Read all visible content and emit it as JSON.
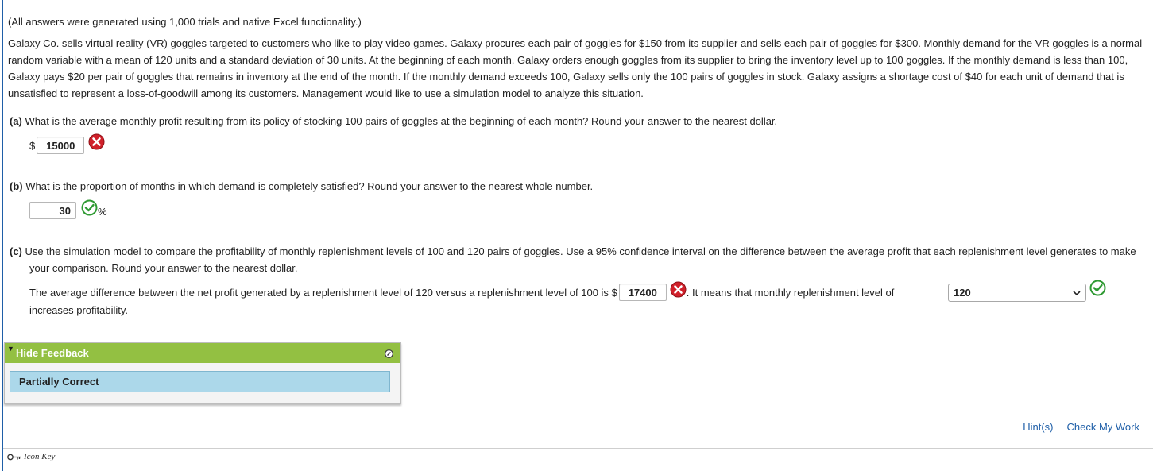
{
  "note": "(All answers were generated using 1,000 trials and native Excel functionality.)",
  "problem_text": "Galaxy Co. sells virtual reality (VR) goggles targeted to customers who like to play video games. Galaxy procures each pair of goggles for $150 from its supplier and sells each pair of goggles for $300. Monthly demand for the VR goggles is a normal random variable with a mean of 120 units and a standard deviation of 30 units. At the beginning of each month, Galaxy orders enough goggles from its supplier to bring the inventory level up to 100 goggles. If the monthly demand is less than 100, Galaxy pays $20 per pair of goggles that remains in inventory at the end of the month. If the monthly demand exceeds 100, Galaxy sells only the 100 pairs of goggles in stock. Galaxy assigns a shortage cost of $40 for each unit of demand that is unsatisfied to represent a loss-of-goodwill among its customers. Management would like to use a simulation model to analyze this situation.",
  "part_a": {
    "label": "(a)",
    "question": "What is the average monthly profit resulting from its policy of stocking 100 pairs of goggles at the beginning of each month? Round your answer to the nearest dollar.",
    "prefix": "$",
    "value": "15000",
    "status_icon": "incorrect-x-icon"
  },
  "part_b": {
    "label": "(b)",
    "question": "What is the proportion of months in which demand is completely satisfied? Round your answer to the nearest whole number.",
    "value": "30",
    "suffix": "%",
    "status_icon": "correct-check-icon"
  },
  "part_c": {
    "label": "(c)",
    "question": "Use the simulation model to compare the profitability of monthly replenishment levels of 100 and 120 pairs of goggles. Use a 95% confidence interval on the difference between the average profit that each replenishment level generates to make your comparison. Round your answer to the nearest dollar.",
    "sentence_before": "The average difference between the net profit generated by a replenishment level of 120 versus a replenishment level of 100 is $",
    "value": "17400",
    "sentence_middle": ". It means that monthly replenishment level of",
    "select_value": "120",
    "sentence_after": "increases profitability."
  },
  "feedback": {
    "header": "Hide Feedback",
    "message": "Partially Correct"
  },
  "links": {
    "hints": "Hint(s)",
    "check": "Check My Work"
  },
  "icon_key": "Icon Key",
  "colors": {
    "feedback_header": "#93c042",
    "feedback_body": "#acd8ea",
    "link": "#1f5fa8",
    "incorrect": "#d0202a",
    "correct": "#2f9a33"
  }
}
